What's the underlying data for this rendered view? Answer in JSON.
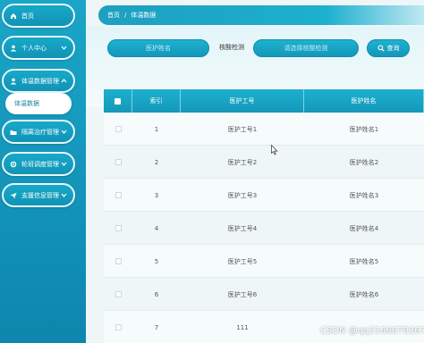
{
  "sidebar": {
    "items": [
      {
        "label": "首页",
        "icon": "home-icon",
        "expandable": false
      },
      {
        "label": "个人中心",
        "icon": "user-icon",
        "expandable": true
      },
      {
        "label": "体温数据管理",
        "icon": "user-icon",
        "expandable": true
      },
      {
        "label": "隔离治疗管理",
        "icon": "folder-icon",
        "expandable": true
      },
      {
        "label": "轮班调度管理",
        "icon": "gear-icon",
        "expandable": true
      },
      {
        "label": "支援信息管理",
        "icon": "send-icon",
        "expandable": true
      }
    ],
    "submenu_active": "体温数据"
  },
  "breadcrumb": {
    "home": "首页",
    "separator": "/",
    "current": "体温数据"
  },
  "search": {
    "name_placeholder": "医护姓名",
    "filter_label": "核酸检测",
    "select_placeholder": "请选择核酸检测",
    "button_label": "查询"
  },
  "table": {
    "headers": {
      "index": "索引",
      "staff_id": "医护工号",
      "staff_name": "医护姓名"
    },
    "rows": [
      {
        "index": "1",
        "staff_id": "医护工号1",
        "staff_name": "医护姓名1"
      },
      {
        "index": "2",
        "staff_id": "医护工号2",
        "staff_name": "医护姓名2"
      },
      {
        "index": "3",
        "staff_id": "医护工号3",
        "staff_name": "医护姓名3"
      },
      {
        "index": "4",
        "staff_id": "医护工号4",
        "staff_name": "医护姓名4"
      },
      {
        "index": "5",
        "staff_id": "医护工号5",
        "staff_name": "医护姓名5"
      },
      {
        "index": "6",
        "staff_id": "医护工号6",
        "staff_name": "医护姓名6"
      },
      {
        "index": "7",
        "staff_id": "111",
        "staff_name": ""
      }
    ]
  },
  "watermark": "CSDN @qq3166678367",
  "colors": {
    "primary": "#1597b9",
    "primary_light": "#1db0cf",
    "background": "#eef6f8"
  }
}
